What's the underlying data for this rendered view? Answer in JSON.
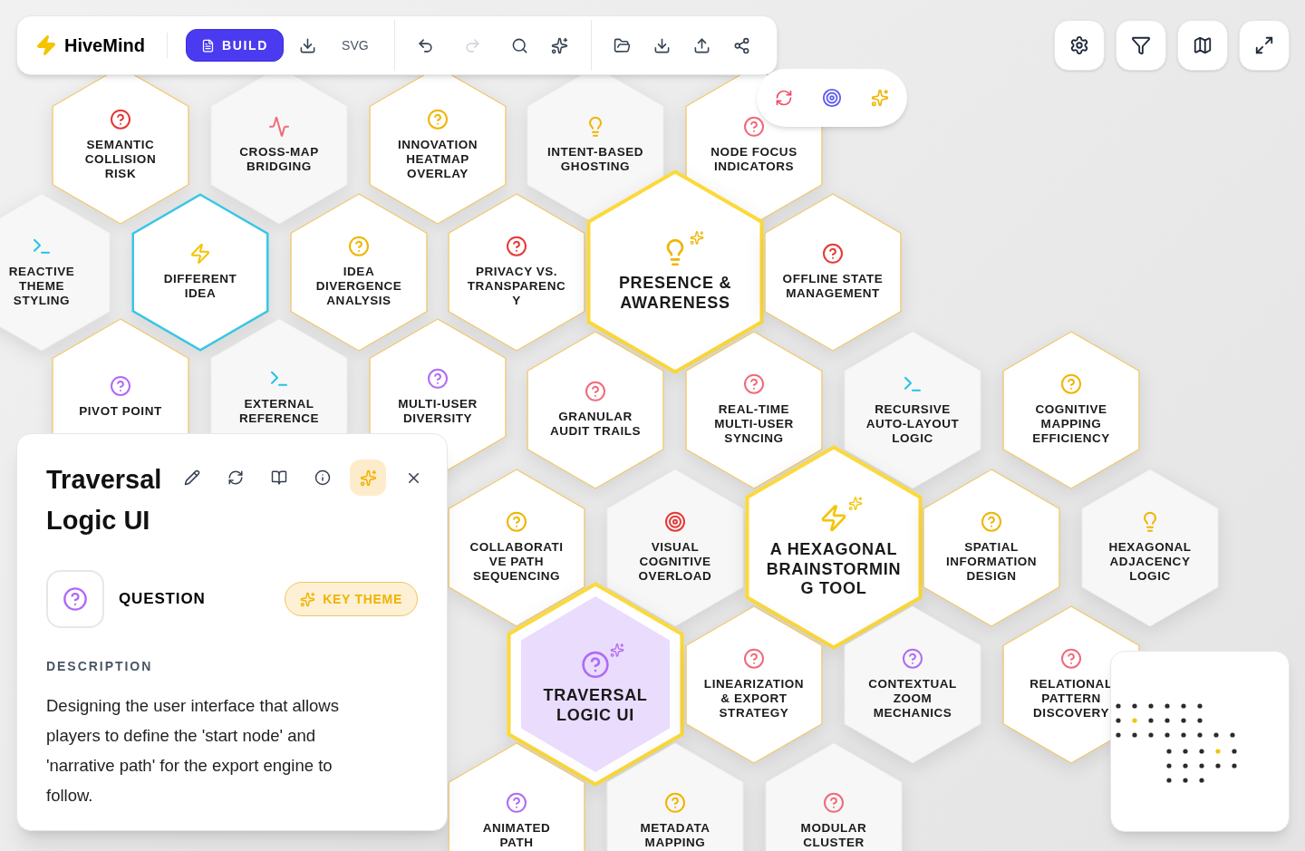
{
  "toolbar": {
    "brand": "HiveMind",
    "build_label": "BUILD",
    "svg_label": "SVG",
    "redo_disabled": true
  },
  "nodes": [
    {
      "label": "SEMANTIC COLLISION RISK",
      "kind": "question",
      "color": "#e53935",
      "outlined": true,
      "focused": false,
      "large": false,
      "selected": false
    },
    {
      "label": "CROSS-MAP BRIDGING",
      "kind": "pulse",
      "color": "#ef6b7b",
      "outlined": false,
      "focused": false,
      "large": false,
      "selected": false
    },
    {
      "label": "INNOVATION HEATMAP OVERLAY",
      "kind": "question",
      "color": "#f0b400",
      "outlined": true,
      "focused": false,
      "large": false,
      "selected": false
    },
    {
      "label": "INTENT-BASED GHOSTING",
      "kind": "bulb",
      "color": "#f0b400",
      "outlined": false,
      "focused": false,
      "large": false,
      "selected": false
    },
    {
      "label": "NODE FOCUS INDICATORS",
      "kind": "question",
      "color": "#ef6b7b",
      "outlined": true,
      "focused": false,
      "large": false,
      "selected": false
    },
    {
      "label": "REACTIVE THEME STYLING",
      "kind": "terminal",
      "color": "#22c3e6",
      "outlined": false,
      "focused": false,
      "large": false,
      "selected": false
    },
    {
      "label": "DIFFERENT IDEA",
      "kind": "bolt",
      "color": "#f5c400",
      "outlined": true,
      "focused": true,
      "large": false,
      "selected": false
    },
    {
      "label": "IDEA DIVERGENCE ANALYSIS",
      "kind": "question",
      "color": "#f0b400",
      "outlined": true,
      "focused": false,
      "large": false,
      "selected": false
    },
    {
      "label": "PRIVACY VS. TRANSPARENCY",
      "kind": "question",
      "color": "#e53935",
      "outlined": true,
      "focused": false,
      "large": false,
      "selected": false
    },
    {
      "label": "PRESENCE & AWARENESS",
      "kind": "bulb",
      "color": "#f0b400",
      "outlined": true,
      "focused": false,
      "large": true,
      "selected": false
    },
    {
      "label": "OFFLINE STATE MANAGEMENT",
      "kind": "question",
      "color": "#e53935",
      "outlined": true,
      "focused": false,
      "large": false,
      "selected": false
    },
    {
      "label": "PIVOT POINT",
      "kind": "question",
      "color": "#b06cf5",
      "outlined": true,
      "focused": false,
      "large": false,
      "selected": false
    },
    {
      "label": "EXTERNAL REFERENCE",
      "kind": "terminal",
      "color": "#22c3e6",
      "outlined": false,
      "focused": false,
      "large": false,
      "selected": false
    },
    {
      "label": "MULTI-USER DIVERSITY",
      "kind": "question",
      "color": "#b06cf5",
      "outlined": true,
      "focused": false,
      "large": false,
      "selected": false
    },
    {
      "label": "GRANULAR AUDIT TRAILS",
      "kind": "question",
      "color": "#ef6b7b",
      "outlined": true,
      "focused": false,
      "large": false,
      "selected": false
    },
    {
      "label": "REAL-TIME MULTI-USER SYNCING",
      "kind": "question",
      "color": "#ef6b7b",
      "outlined": true,
      "focused": false,
      "large": false,
      "selected": false
    },
    {
      "label": "RECURSIVE AUTO-LAYOUT LOGIC",
      "kind": "terminal",
      "color": "#22c3e6",
      "outlined": false,
      "focused": false,
      "large": false,
      "selected": false
    },
    {
      "label": "COGNITIVE MAPPING EFFICIENCY",
      "kind": "question",
      "color": "#f0b400",
      "outlined": true,
      "focused": false,
      "large": false,
      "selected": false
    },
    {
      "label": "COLLABORATIVE PATH SEQUENCING",
      "kind": "question",
      "color": "#f0b400",
      "outlined": true,
      "focused": false,
      "large": false,
      "selected": false
    },
    {
      "label": "VISUAL COGNITIVE OVERLOAD",
      "kind": "target",
      "color": "#e53935",
      "outlined": false,
      "focused": false,
      "large": false,
      "selected": false
    },
    {
      "label": "A HEXAGONAL BRAINSTORMING TOOL",
      "kind": "bolt",
      "color": "#f5c400",
      "outlined": true,
      "focused": false,
      "large": true,
      "selected": false
    },
    {
      "label": "SPATIAL INFORMATION DESIGN",
      "kind": "question",
      "color": "#f0b400",
      "outlined": true,
      "focused": false,
      "large": false,
      "selected": false
    },
    {
      "label": "HEXAGONAL ADJACENCY LOGIC",
      "kind": "bulb",
      "color": "#f0b400",
      "outlined": false,
      "focused": false,
      "large": false,
      "selected": false
    },
    {
      "label": "TRAVERSAL LOGIC UI",
      "kind": "question",
      "color": "#b06cf5",
      "outlined": true,
      "focused": false,
      "large": true,
      "selected": true
    },
    {
      "label": "LINEARIZATION & EXPORT STRATEGY",
      "kind": "question",
      "color": "#ef6b7b",
      "outlined": true,
      "focused": false,
      "large": false,
      "selected": false
    },
    {
      "label": "CONTEXTUAL ZOOM MECHANICS",
      "kind": "question",
      "color": "#b06cf5",
      "outlined": false,
      "focused": false,
      "large": false,
      "selected": false
    },
    {
      "label": "RELATIONAL PATTERN DISCOVERY",
      "kind": "question",
      "color": "#ef6b7b",
      "outlined": true,
      "focused": false,
      "large": false,
      "selected": false
    },
    {
      "label": "ANIMATED PATH",
      "kind": "question",
      "color": "#b06cf5",
      "outlined": true,
      "focused": false,
      "large": false,
      "selected": false
    },
    {
      "label": "METADATA MAPPING",
      "kind": "question",
      "color": "#f0b400",
      "outlined": false,
      "focused": false,
      "large": false,
      "selected": false
    },
    {
      "label": "MODULAR CLUSTER",
      "kind": "question",
      "color": "#ef6b7b",
      "outlined": false,
      "focused": false,
      "large": false,
      "selected": false
    }
  ],
  "detail": {
    "title": "Traversal Logic UI",
    "type_label": "QUESTION",
    "theme_label": "KEY THEME",
    "ai_active": true,
    "section_label": "DESCRIPTION",
    "description": "Designing the user interface that allows players to define the 'start node' and 'narrative path' for the export engine to follow."
  }
}
